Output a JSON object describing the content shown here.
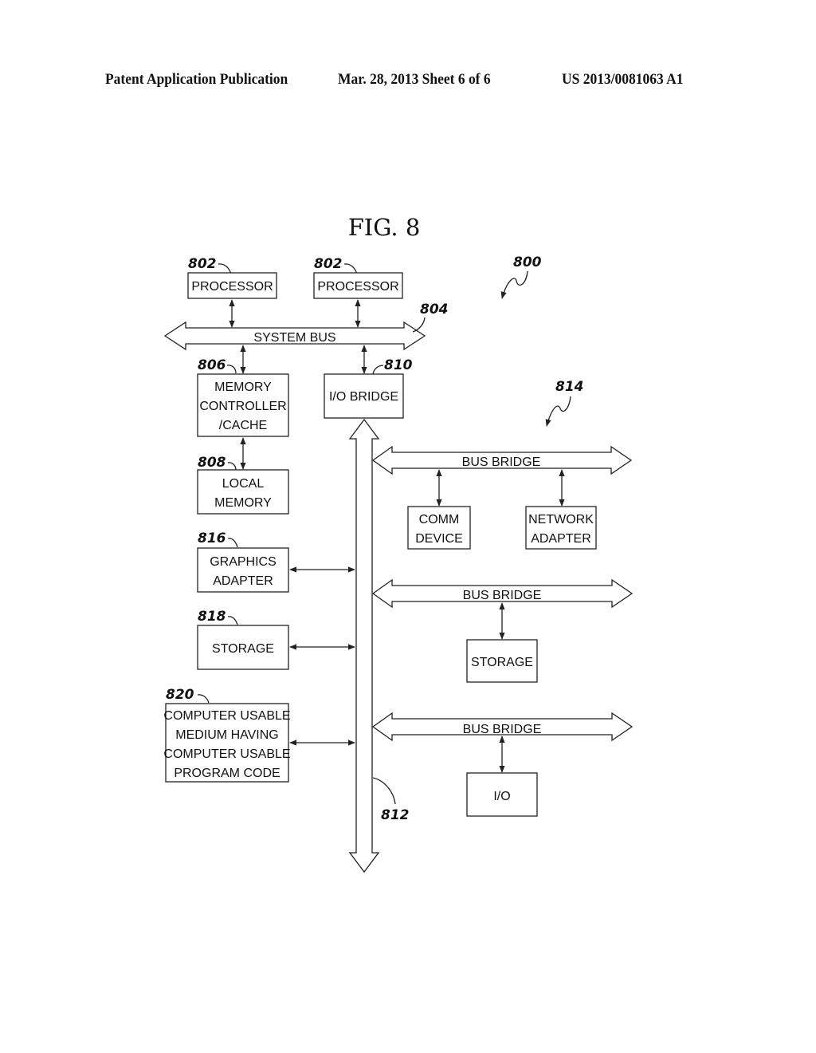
{
  "header": {
    "publication": "Patent Application Publication",
    "date_sheet": "Mar. 28, 2013  Sheet 6 of 6",
    "patent_number": "US 2013/0081063 A1"
  },
  "figure": {
    "title": "FIG. 8",
    "system_ref": "800",
    "group_ref": "814",
    "system_bus": {
      "label": "SYSTEM BUS",
      "ref": "804"
    },
    "io_bus": {
      "ref": "812"
    },
    "processors": [
      {
        "label": "PROCESSOR",
        "ref": "802"
      },
      {
        "label": "PROCESSOR",
        "ref": "802"
      }
    ],
    "memory_controller": {
      "lines": [
        "MEMORY",
        "CONTROLLER",
        "/CACHE"
      ],
      "ref": "806"
    },
    "local_memory": {
      "lines": [
        "LOCAL",
        "MEMORY"
      ],
      "ref": "808"
    },
    "io_bridge": {
      "label": "I/O BRIDGE",
      "ref": "810"
    },
    "graphics_adapter": {
      "lines": [
        "GRAPHICS",
        "ADAPTER"
      ],
      "ref": "816"
    },
    "storage_left": {
      "label": "STORAGE",
      "ref": "818"
    },
    "program_medium": {
      "lines": [
        "COMPUTER USABLE",
        "MEDIUM HAVING",
        "COMPUTER USABLE",
        "PROGRAM CODE"
      ],
      "ref": "820"
    },
    "bus_bridges": [
      {
        "label": "BUS BRIDGE",
        "devices": [
          {
            "lines": [
              "COMM",
              "DEVICE"
            ]
          },
          {
            "lines": [
              "NETWORK",
              "ADAPTER"
            ]
          }
        ]
      },
      {
        "label": "BUS BRIDGE",
        "devices": [
          {
            "lines": [
              "STORAGE"
            ]
          }
        ]
      },
      {
        "label": "BUS BRIDGE",
        "devices": [
          {
            "lines": [
              "I/O"
            ]
          }
        ]
      }
    ]
  }
}
